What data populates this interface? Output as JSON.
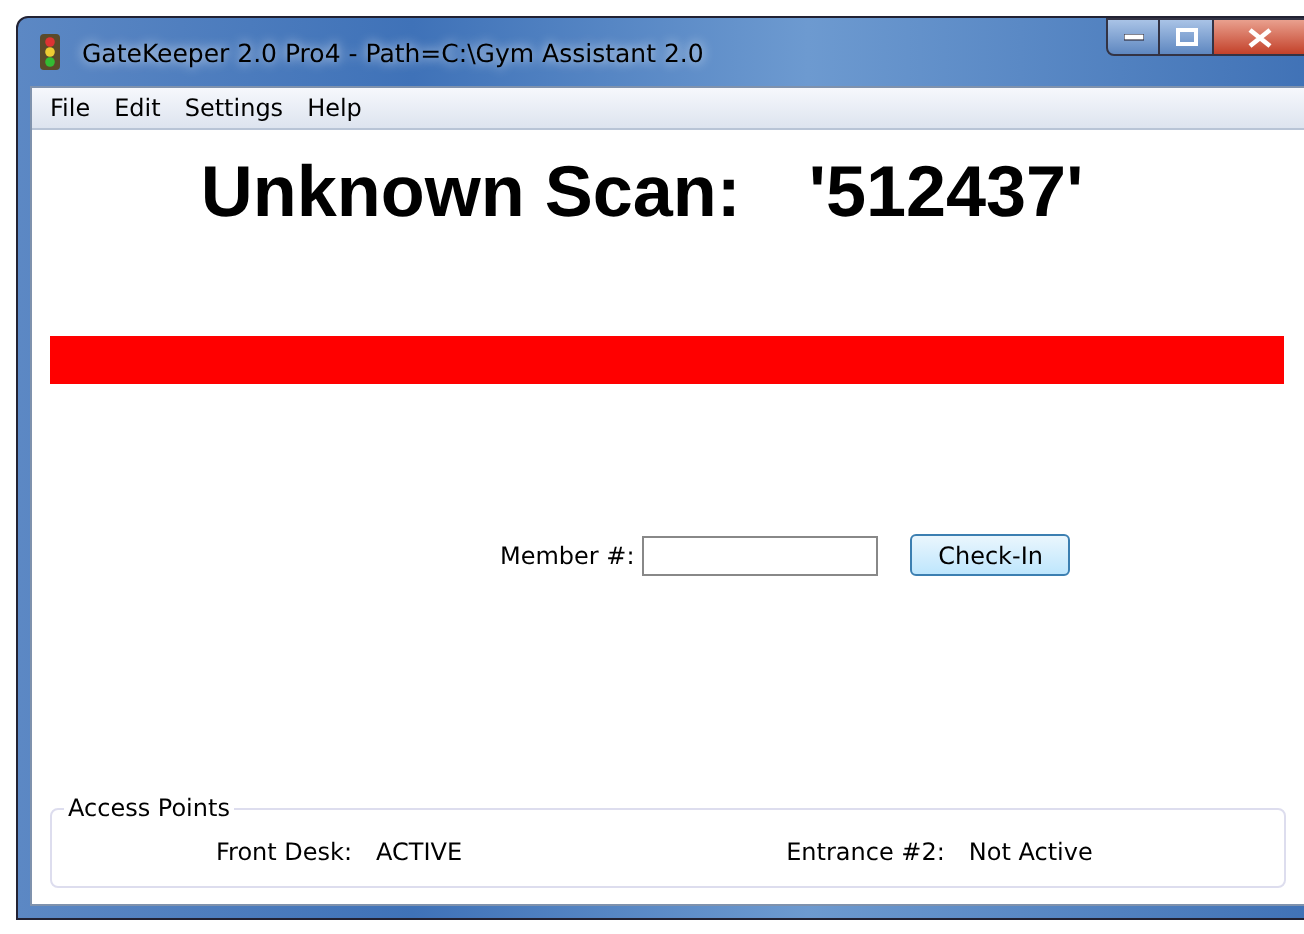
{
  "window": {
    "title": "GateKeeper 2.0 Pro4 - Path=C:\\Gym Assistant 2.0"
  },
  "menu": [
    "File",
    "Edit",
    "Settings",
    "Help"
  ],
  "scan_message": {
    "label": "Unknown Scan:",
    "value": "'512437'"
  },
  "check_in": {
    "label": "Member #:",
    "button": "Check-In"
  },
  "access_points": {
    "title": "Access Points",
    "items": [
      {
        "name": "Front Desk:",
        "status": "ACTIVE"
      },
      {
        "name": "Entrance #2:",
        "status": "Not Active"
      }
    ]
  }
}
